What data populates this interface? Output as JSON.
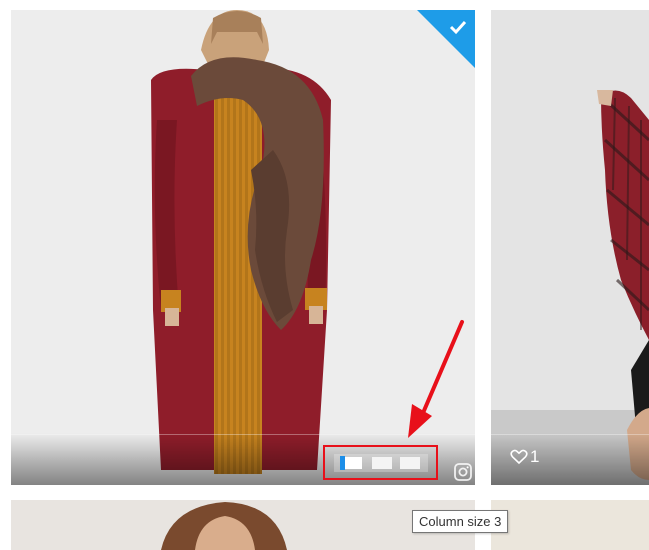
{
  "gallery": {
    "items": [
      {
        "selected": true,
        "column_size_control": {
          "segments": 3,
          "active_segment": 1
        }
      },
      {
        "likes": "1"
      },
      {},
      {}
    ]
  },
  "icons": {
    "selected": "check-icon",
    "like": "heart-icon",
    "share": "instagram-icon"
  },
  "tooltip": {
    "text": "Column size 3"
  },
  "colors": {
    "selected_corner": "#1e9ce8",
    "highlight_border": "#e8101a",
    "annotation_arrow": "#e8101a",
    "slider_handle": "#1c8ee8"
  }
}
